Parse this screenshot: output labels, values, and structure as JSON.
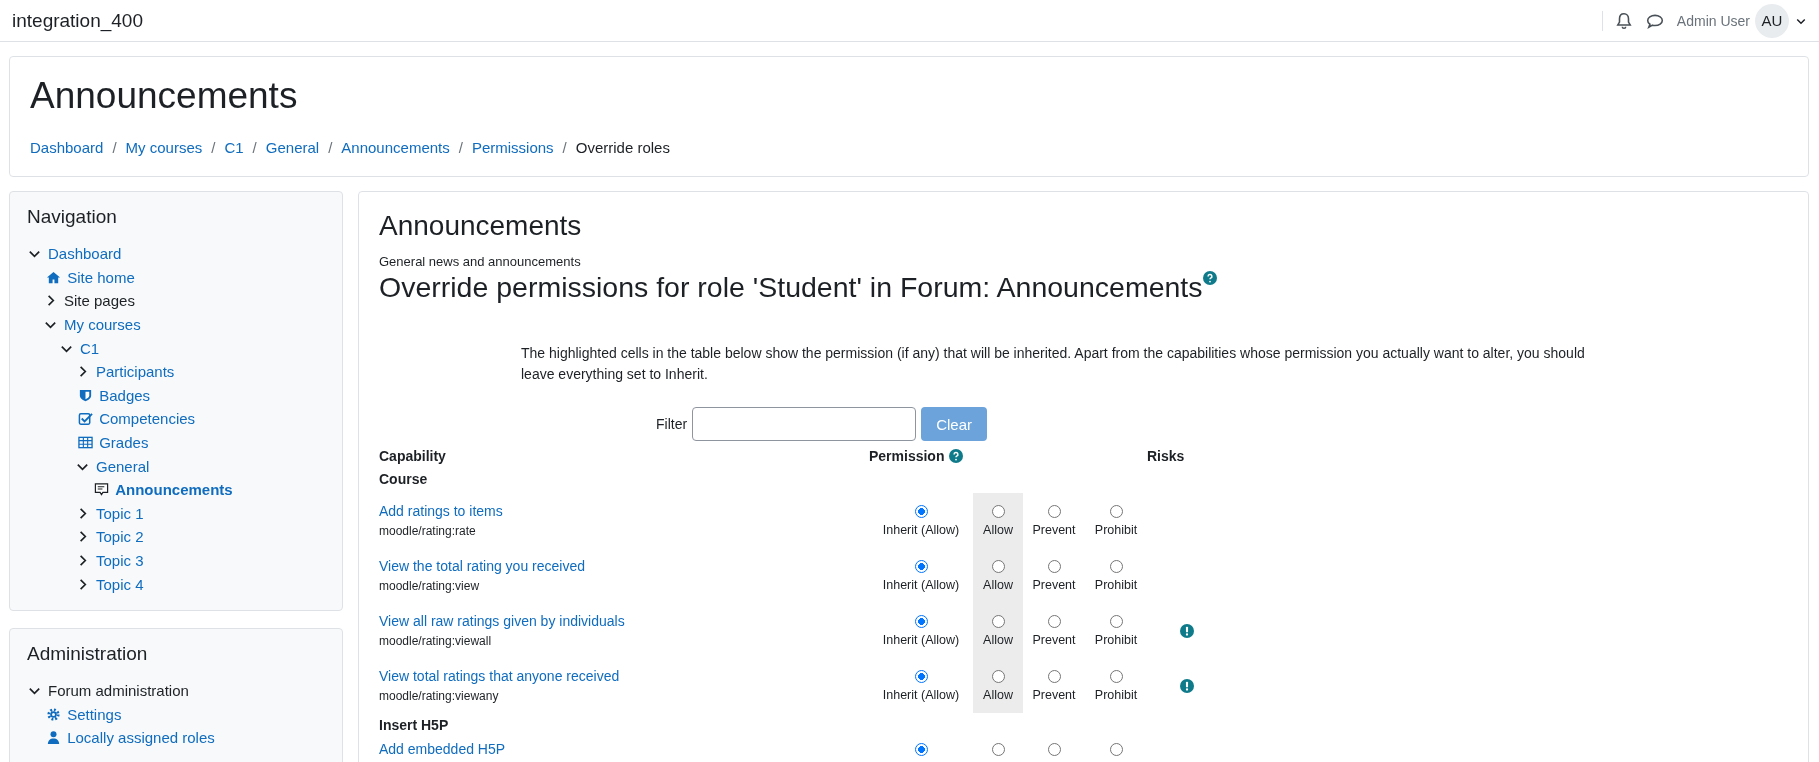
{
  "site_name": "integration_400",
  "user": {
    "name": "Admin User",
    "initials": "AU"
  },
  "header": {
    "title": "Announcements",
    "separator": "/",
    "breadcrumbs": [
      {
        "label": "Dashboard",
        "link": true
      },
      {
        "label": "My courses",
        "link": true
      },
      {
        "label": "C1",
        "link": true
      },
      {
        "label": "General",
        "link": true
      },
      {
        "label": "Announcements",
        "link": true
      },
      {
        "label": "Permissions",
        "link": true
      },
      {
        "label": "Override roles",
        "link": false
      }
    ]
  },
  "navigation": {
    "title": "Navigation",
    "items": [
      {
        "label": "Dashboard",
        "kind": "branch",
        "expanded": true,
        "link": true,
        "selected": false,
        "children": [
          {
            "label": "Site home",
            "kind": "home",
            "link": true,
            "selected": false
          },
          {
            "label": "Site pages",
            "kind": "branch",
            "expanded": false,
            "link": false,
            "selected": false
          },
          {
            "label": "My courses",
            "kind": "branch",
            "expanded": true,
            "link": true,
            "selected": false,
            "children": [
              {
                "label": "C1",
                "kind": "branch",
                "expanded": true,
                "link": true,
                "selected": false,
                "children": [
                  {
                    "label": "Participants",
                    "kind": "branch",
                    "expanded": false,
                    "link": true,
                    "selected": false
                  },
                  {
                    "label": "Badges",
                    "kind": "shield",
                    "link": true,
                    "selected": false
                  },
                  {
                    "label": "Competencies",
                    "kind": "check",
                    "link": true,
                    "selected": false
                  },
                  {
                    "label": "Grades",
                    "kind": "grid",
                    "link": true,
                    "selected": false
                  },
                  {
                    "label": "General",
                    "kind": "branch",
                    "expanded": true,
                    "link": true,
                    "selected": false,
                    "children": [
                      {
                        "label": "Announcements",
                        "kind": "forum",
                        "link": true,
                        "selected": true
                      }
                    ]
                  },
                  {
                    "label": "Topic 1",
                    "kind": "branch",
                    "expanded": false,
                    "link": true,
                    "selected": false
                  },
                  {
                    "label": "Topic 2",
                    "kind": "branch",
                    "expanded": false,
                    "link": true,
                    "selected": false
                  },
                  {
                    "label": "Topic 3",
                    "kind": "branch",
                    "expanded": false,
                    "link": true,
                    "selected": false
                  },
                  {
                    "label": "Topic 4",
                    "kind": "branch",
                    "expanded": false,
                    "link": true,
                    "selected": false
                  }
                ]
              }
            ]
          }
        ]
      }
    ]
  },
  "administration": {
    "title": "Administration",
    "items": [
      {
        "label": "Forum administration",
        "kind": "branch",
        "expanded": true,
        "link": false,
        "selected": false,
        "children": [
          {
            "label": "Settings",
            "kind": "gear",
            "link": true,
            "selected": false
          },
          {
            "label": "Locally assigned roles",
            "kind": "user",
            "link": true,
            "selected": false
          }
        ]
      }
    ]
  },
  "main": {
    "title": "Announcements",
    "description": "General news and announcements",
    "heading": "Override permissions for role 'Student' in Forum: Announcements",
    "info": "The highlighted cells in the table below show the permission (if any) that will be inherited. Apart from the capabilities whose permission you actually want to alter, you should leave everything set to Inherit.",
    "filter": {
      "label": "Filter",
      "button": "Clear"
    },
    "table": {
      "columns": [
        "Capability",
        "Permission",
        "Risks"
      ],
      "rows": [
        {
          "kind": "section",
          "label": "Course"
        },
        {
          "kind": "capability",
          "label": "Add ratings to items",
          "code": "moodle/rating:rate",
          "risk": false,
          "options": [
            {
              "label": "Inherit (Allow)",
              "selected": true,
              "highlighted": false
            },
            {
              "label": "Allow",
              "selected": false,
              "highlighted": true
            },
            {
              "label": "Prevent",
              "selected": false,
              "highlighted": false
            },
            {
              "label": "Prohibit",
              "selected": false,
              "highlighted": false
            }
          ]
        },
        {
          "kind": "capability",
          "label": "View the total rating you received",
          "code": "moodle/rating:view",
          "risk": false,
          "options": [
            {
              "label": "Inherit (Allow)",
              "selected": true,
              "highlighted": false
            },
            {
              "label": "Allow",
              "selected": false,
              "highlighted": true
            },
            {
              "label": "Prevent",
              "selected": false,
              "highlighted": false
            },
            {
              "label": "Prohibit",
              "selected": false,
              "highlighted": false
            }
          ]
        },
        {
          "kind": "capability",
          "label": "View all raw ratings given by individuals",
          "code": "moodle/rating:viewall",
          "risk": true,
          "options": [
            {
              "label": "Inherit (Allow)",
              "selected": true,
              "highlighted": false
            },
            {
              "label": "Allow",
              "selected": false,
              "highlighted": true
            },
            {
              "label": "Prevent",
              "selected": false,
              "highlighted": false
            },
            {
              "label": "Prohibit",
              "selected": false,
              "highlighted": false
            }
          ]
        },
        {
          "kind": "capability",
          "label": "View total ratings that anyone received",
          "code": "moodle/rating:viewany",
          "risk": true,
          "options": [
            {
              "label": "Inherit (Allow)",
              "selected": true,
              "highlighted": false
            },
            {
              "label": "Allow",
              "selected": false,
              "highlighted": true
            },
            {
              "label": "Prevent",
              "selected": false,
              "highlighted": false
            },
            {
              "label": "Prohibit",
              "selected": false,
              "highlighted": false
            }
          ]
        },
        {
          "kind": "section",
          "label": "Insert H5P"
        },
        {
          "kind": "capability",
          "label": "Add embedded H5P",
          "risk": false,
          "options": [
            {
              "selected": true,
              "highlighted": false
            },
            {
              "selected": false,
              "highlighted": false
            },
            {
              "selected": false,
              "highlighted": false
            },
            {
              "selected": false,
              "highlighted": false
            }
          ]
        }
      ]
    }
  }
}
